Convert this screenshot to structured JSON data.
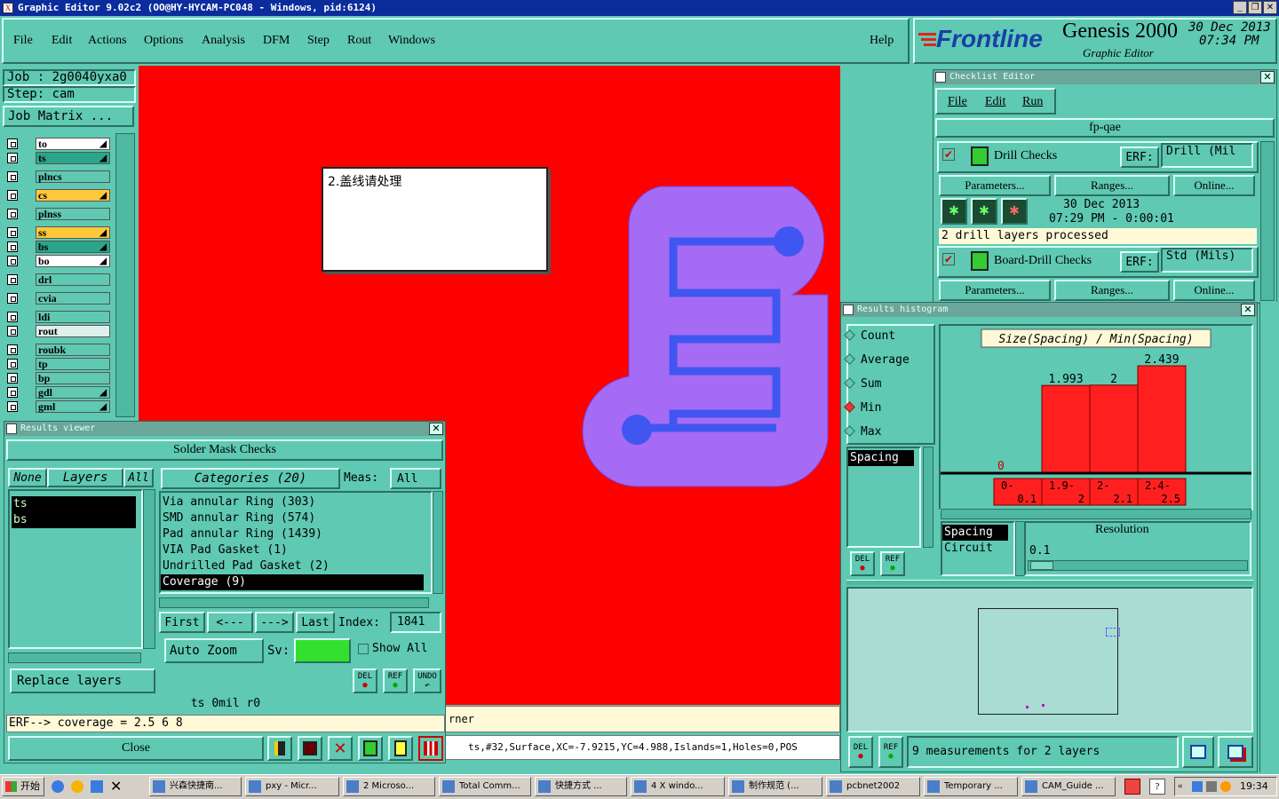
{
  "window": {
    "title": "Graphic Editor 9.02c2 (OO@HY-HYCAM-PC048 - Windows, pid:6124)"
  },
  "menubar": {
    "items": [
      "File",
      "Edit",
      "Actions",
      "Options",
      "Analysis",
      "DFM",
      "Step",
      "Rout",
      "Windows"
    ],
    "help": "Help"
  },
  "brand": {
    "logo": "Frontline",
    "product": "Genesis 2000",
    "subtitle": "Graphic Editor",
    "date": "30 Dec 2013",
    "time": "07:34 PM"
  },
  "job": {
    "job_line": "Job : 2g0040yxa0",
    "step_line": "Step: cam",
    "matrix_button": "Job Matrix ..."
  },
  "layers": [
    {
      "name": "to",
      "color": "#ffffff",
      "mark": true
    },
    {
      "name": "ts",
      "color": "#2aa58a",
      "mark": true
    },
    {
      "name": "plncs",
      "color": "#5fc9b3",
      "mark": false
    },
    {
      "name": "cs",
      "color": "#ffc83a",
      "mark": true
    },
    {
      "name": "plnss",
      "color": "#5fc9b3",
      "mark": false
    },
    {
      "name": "ss",
      "color": "#ffc83a",
      "mark": true
    },
    {
      "name": "bs",
      "color": "#2aa58a",
      "mark": true
    },
    {
      "name": "bo",
      "color": "#ffffff",
      "mark": true
    },
    {
      "name": "drl",
      "color": "#5fc9b3",
      "mark": false
    },
    {
      "name": "cvia",
      "color": "#5fc9b3",
      "mark": false
    },
    {
      "name": "ldi",
      "color": "#5fc9b3",
      "mark": false
    },
    {
      "name": "rout",
      "color": "#dff0ec",
      "mark": false
    },
    {
      "name": "roubk",
      "color": "#5fc9b3",
      "mark": false
    },
    {
      "name": "tp",
      "color": "#5fc9b3",
      "mark": false
    },
    {
      "name": "bp",
      "color": "#5fc9b3",
      "mark": false
    },
    {
      "name": "gdl",
      "color": "#5fc9b3",
      "mark": true
    },
    {
      "name": "gml",
      "color": "#5fc9b3",
      "mark": true
    }
  ],
  "canvas": {
    "note": "2.盖线请处理",
    "status_fragment": "rner",
    "coords": "ts,#32,Surface,XC=-7.9215,YC=4.988,Islands=1,Holes=0,POS",
    "colors": {
      "background": "#ff0000",
      "pad": "#a56bf5",
      "trace": "#3f57f0"
    }
  },
  "results_viewer": {
    "title": "Results viewer",
    "header": "Solder Mask Checks",
    "none": "None",
    "layers": "Layers",
    "all": "All",
    "categories_label": "Categories (20)",
    "meas_label": "Meas:",
    "meas_value": "All",
    "layer_list": [
      "ts",
      "bs"
    ],
    "categories": [
      "Via annular Ring (303)",
      "SMD annular Ring (574)",
      "Pad annular Ring (1439)",
      "VIA Pad Gasket (1)",
      "Undrilled Pad Gasket (2)",
      "Coverage (9)"
    ],
    "nav": [
      "First",
      "<---",
      "--->",
      "Last"
    ],
    "index_label": "Index:",
    "index_value": "1841",
    "auto_zoom": "Auto Zoom",
    "sv_label": "Sv:",
    "show_all": "Show All",
    "replace_layers": "Replace layers",
    "del": "DEL",
    "ref": "REF",
    "undo": "UNDO",
    "layer_info": "ts 0mil r0",
    "erf_line": "ERF--> coverage = 2.5 6 8",
    "close": "Close"
  },
  "checklist": {
    "title": "Checklist Editor",
    "menu": [
      "File",
      "Edit",
      "Run"
    ],
    "name": "fp-qae",
    "drill": {
      "label": "Drill Checks",
      "erf": "ERF:",
      "erf_value": "Drill (Mil",
      "params": "Parameters...",
      "ranges": "Ranges...",
      "online": "Online...",
      "date": "30 Dec 2013",
      "time": "07:29 PM - 0:00:01",
      "status": "2 drill layers processed"
    },
    "board": {
      "label": "Board-Drill Checks",
      "erf": "ERF:",
      "erf_value": "Std (Mils)",
      "params": "Parameters...",
      "ranges": "Ranges...",
      "online": "Online..."
    }
  },
  "histogram": {
    "title": "Results histogram",
    "modes": [
      "Count",
      "Average",
      "Sum",
      "Min",
      "Max"
    ],
    "selected_mode": "Min",
    "list": [
      "Spacing"
    ],
    "chart_title": "Size(Spacing) / Min(Spacing)",
    "resolution_label": "Resolution",
    "resolution_value": "0.1",
    "types": [
      "Spacing",
      "Circuit"
    ],
    "del": "DEL",
    "ref": "REF",
    "summary": "9 measurements for 2 layers"
  },
  "chart_data": {
    "type": "bar",
    "title": "Size(Spacing) / Min(Spacing)",
    "categories": [
      "0-0.1",
      "1.9-2",
      "2-2.1",
      "2.4-2.5"
    ],
    "values": [
      0,
      1.993,
      2,
      2.439
    ],
    "ylim": [
      0,
      2.5
    ],
    "grid": false
  },
  "taskbar": {
    "start": "开始",
    "tasks": [
      "兴森快捷南...",
      "pxy - Micr...",
      "2 Microso...",
      "Total Comm...",
      "快捷方式 ...",
      "4 X windo...",
      "制作规范 (...",
      "pcbnet2002",
      "Temporary ...",
      "CAM_Guide ..."
    ],
    "clock": "19:34"
  }
}
